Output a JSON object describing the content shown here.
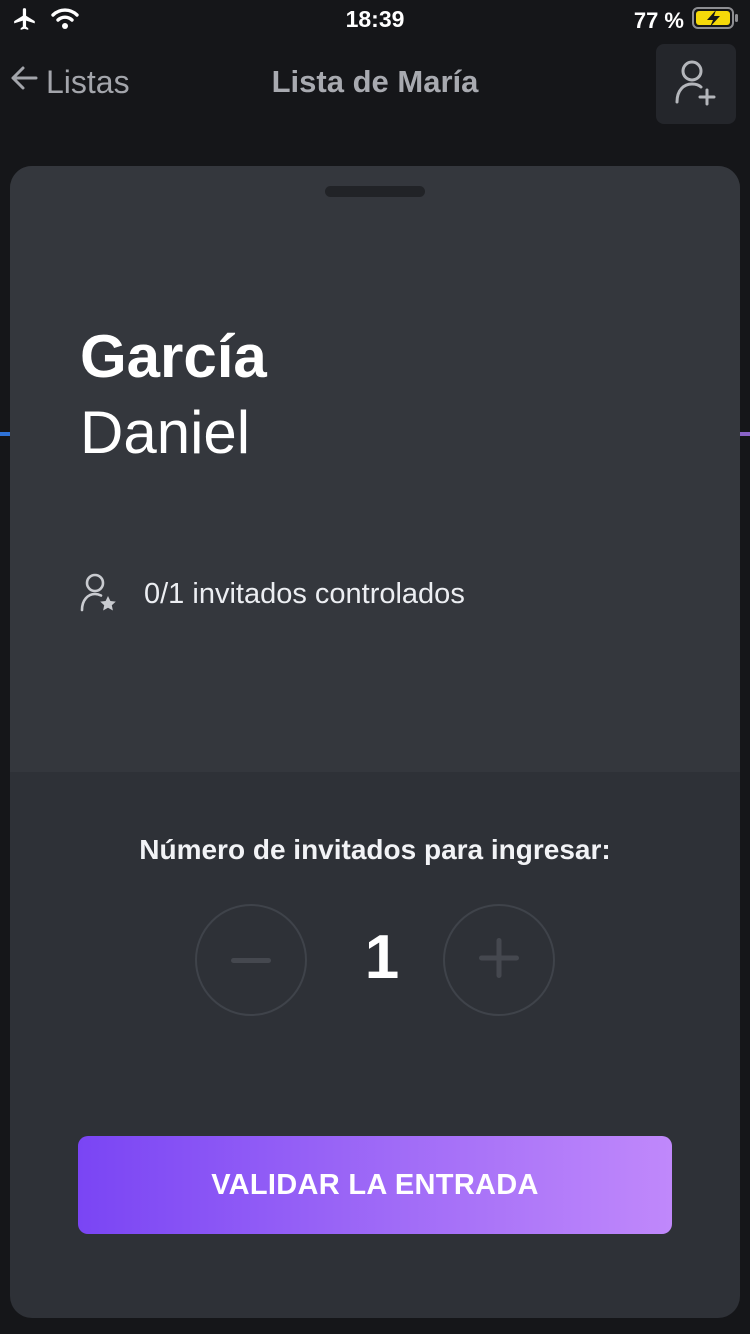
{
  "status_bar": {
    "time": "18:39",
    "battery_percent": "77 %",
    "battery_level": 0.77,
    "icons": [
      "airplane-icon",
      "wifi-icon",
      "battery-charging-icon"
    ]
  },
  "nav": {
    "back_label": "Listas",
    "title": "Lista de María",
    "icons": [
      "arrow-left-icon",
      "add-person-icon"
    ]
  },
  "guest": {
    "last_name": "García",
    "first_name": "Daniel",
    "controlled_text": "0/1 invitados controlados",
    "icon": "person-star-icon"
  },
  "entry": {
    "question": "Número de invitados para ingresar:",
    "quantity": "1",
    "icons": [
      "minus-icon",
      "plus-icon"
    ]
  },
  "cta": {
    "label": "VALIDAR LA ENTRADA"
  },
  "colors": {
    "background": "#151619",
    "sheet": "#2e3137",
    "sheet_top": "#34373d",
    "cta_gradient_start": "#7a45f4",
    "cta_gradient_end": "#c088fb",
    "battery_charging": "#f5d90a"
  }
}
